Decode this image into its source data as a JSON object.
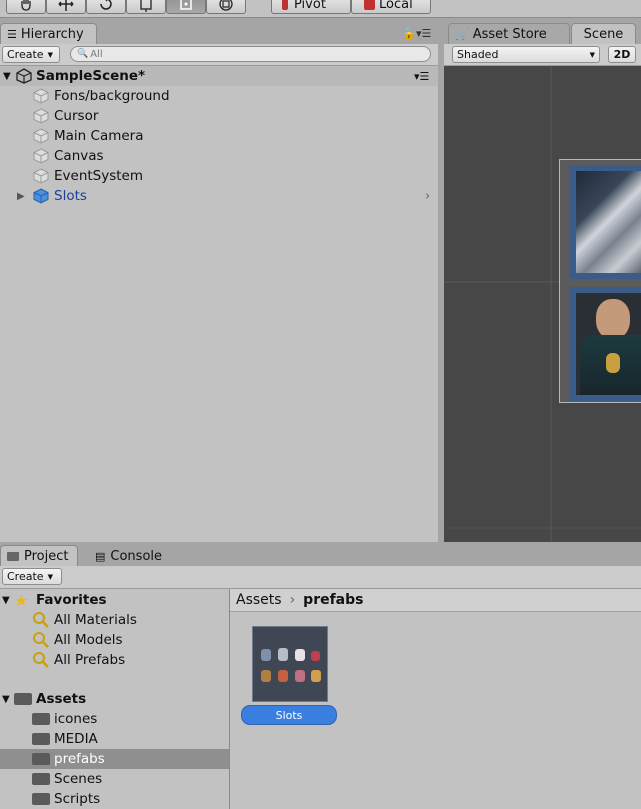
{
  "toolbar": {
    "tools": [
      "hand-tool",
      "move-tool",
      "rotate-tool",
      "scale-tool",
      "rect-tool",
      "transform-tool"
    ],
    "pivot_label": "Pivot",
    "local_label": "Local"
  },
  "hierarchy": {
    "tab_label": "Hierarchy",
    "create_label": "Create",
    "search_placeholder": "All",
    "scene_name": "SampleScene*",
    "items": [
      {
        "label": "Fons/background"
      },
      {
        "label": "Cursor"
      },
      {
        "label": "Main Camera"
      },
      {
        "label": "Canvas"
      },
      {
        "label": "EventSystem"
      },
      {
        "label": "Slots",
        "prefab": true
      }
    ]
  },
  "scene": {
    "tabs": [
      "Asset Store",
      "Scene"
    ],
    "active_tab": "Scene",
    "shading_mode": "Shaded",
    "mode_2d_label": "2D",
    "background_color": "#474747",
    "slot_border_color": "#3b5b88"
  },
  "bottom": {
    "tabs": [
      "Project",
      "Console"
    ],
    "active_tab": "Project",
    "create_label": "Create"
  },
  "project_tree": {
    "favorites_label": "Favorites",
    "favorites": [
      "All Materials",
      "All Models",
      "All Prefabs"
    ],
    "assets_label": "Assets",
    "folders": [
      "icones",
      "MEDIA",
      "prefabs",
      "Scenes",
      "Scripts"
    ],
    "selected_folder": "prefabs"
  },
  "breadcrumb": {
    "root": "Assets",
    "current": "prefabs"
  },
  "assets_grid": {
    "items": [
      {
        "label": "Slots",
        "selected": true
      }
    ],
    "selection_color": "#3a7fe0"
  }
}
